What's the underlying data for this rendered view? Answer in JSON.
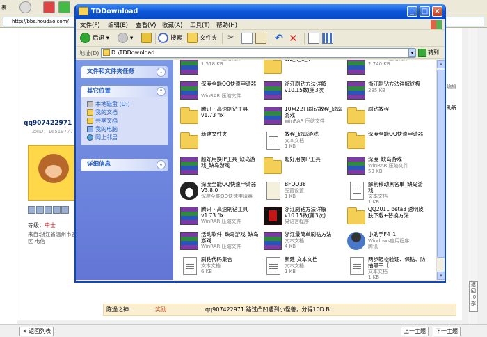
{
  "browser": {
    "url": "http://bbs.houdao.com/",
    "tabs_hint": "表",
    "user": {
      "name": "qq907422971",
      "uid": "ZxID：16519777",
      "rank_label": "等级：",
      "rank_value": "中士",
      "from": "来自:浙江省温州市鹿",
      "from2": "区 电信"
    },
    "message": {
      "author": "陈過之神",
      "tag": "奖励",
      "text": "qq907422971 路过凸凹遇到小怪兽，分得10D B"
    },
    "bottom": {
      "back": "< 返回列表",
      "prev": "上一主题",
      "next": "下一主题"
    },
    "side_tab": "返回顶部",
    "side_text_1": "助解",
    "side_text_2": "编辑"
  },
  "window": {
    "title": "TDDownload",
    "menu": [
      "文件(F)",
      "编辑(E)",
      "查看(V)",
      "收藏(A)",
      "工具(T)",
      "帮助(H)"
    ],
    "toolbar": {
      "back": "后退",
      "search": "搜索",
      "folders": "文件夹"
    },
    "address": {
      "label": "地址(D)",
      "value": "D:\\TDDownload",
      "go": "转到"
    },
    "tasks": {
      "file_tasks": "文件和文件夹任务",
      "other_places": "其它位置",
      "places": [
        "本地磁盘 (D:)",
        "我的文档",
        "共享文档",
        "我的电脑",
        "网上邻居"
      ],
      "details": "详细信息"
    },
    "files": [
      {
        "name": "",
        "type": "WinRAR 压缩文件",
        "size": "1,518 KB",
        "icon": "rar"
      },
      {
        "name": "WL_4_1_4",
        "type": "",
        "size": "",
        "icon": "folder"
      },
      {
        "name": "",
        "type": "WinRAR 压缩文件",
        "size": "2,740 KB",
        "icon": "rar"
      },
      {
        "name": "深度全能QQ快速申请器",
        "type": "WinRAR 压缩文件",
        "size": "",
        "icon": "rar"
      },
      {
        "name": "浙江刷钻方法详解v10.15数(第3次",
        "type": "",
        "size": "",
        "icon": "rar"
      },
      {
        "name": "浙江刷钻方法详解终极",
        "type": "",
        "size": "285 KB",
        "icon": "rar"
      },
      {
        "name": "腾讯・高速刷钻工具v1.73 fix",
        "type": "",
        "size": "",
        "icon": "folder"
      },
      {
        "name": "10月22日刷钻教程_缺岛游戏",
        "type": "WinRAR 压缩文件",
        "size": "",
        "icon": "rar"
      },
      {
        "name": "刷钻教程",
        "type": "",
        "size": "",
        "icon": "folder"
      },
      {
        "name": "新建文件夹",
        "type": "",
        "size": "",
        "icon": "folder"
      },
      {
        "name": "教程_缺岛游戏",
        "type": "文本文档",
        "size": "1 KB",
        "icon": "txt"
      },
      {
        "name": "深度全能QQ快速申请器",
        "type": "",
        "size": "",
        "icon": "folder"
      },
      {
        "name": "超好用换IP工具_缺岛游戏_缺岛游戏",
        "type": "",
        "size": "",
        "icon": "rar"
      },
      {
        "name": "超好用换IP工具",
        "type": "",
        "size": "",
        "icon": "folder"
      },
      {
        "name": "深度_缺岛游戏",
        "type": "WinRAR 压缩文件",
        "size": "59 KB",
        "icon": "rar"
      },
      {
        "name": "深度全能QQ快速申请器 V3.8.0",
        "type": "深度全能QQ快速申请器",
        "size": "",
        "icon": "penguin"
      },
      {
        "name": "BFQQ38",
        "type": "配置设置",
        "size": "1 KB",
        "icon": "ini"
      },
      {
        "name": "解制移动黑名单_缺岛游戏",
        "type": "文本文档",
        "size": "1 KB",
        "icon": "txt"
      },
      {
        "name": "腾讯・高速刷钻工具v1.73 fix",
        "type": "WinRAR 压缩文件",
        "size": "",
        "icon": "rar"
      },
      {
        "name": "浙江刷钻方法详解v10.15数(第3次)",
        "type": "易语言程序",
        "size": "",
        "icon": "redimg"
      },
      {
        "name": "QQ2011 beta3 透明皮肤下载+替换方法",
        "type": "",
        "size": "",
        "icon": "folder"
      },
      {
        "name": "活动软件_缺岛游戏_缺岛游戏",
        "type": "WinRAR 压缩文件",
        "size": "",
        "icon": "rar"
      },
      {
        "name": "浙江最简单刷钻方法",
        "type": "文本文档",
        "size": "4 KB",
        "icon": "rar"
      },
      {
        "name": "小助手F4_1",
        "type": "Windows应用程序",
        "size": "腾讯",
        "icon": "man"
      },
      {
        "name": "刷钻代码集合",
        "type": "文本文档",
        "size": "6 KB",
        "icon": "txt"
      },
      {
        "name": "新建 文本文档",
        "type": "文本文档",
        "size": "1 KB",
        "icon": "txt"
      },
      {
        "name": "两步轻松验证、保钻、防抽黑干【...",
        "type": "文本文档",
        "size": "1 KB",
        "icon": "txt"
      }
    ]
  }
}
